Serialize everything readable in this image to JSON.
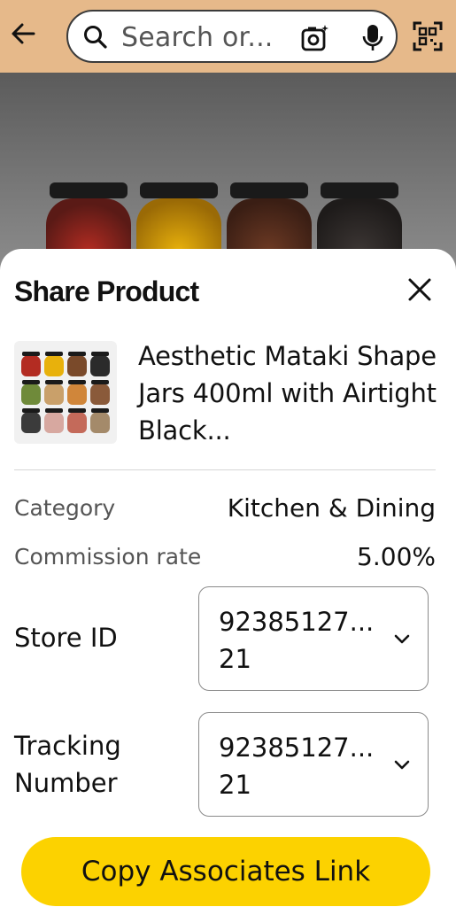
{
  "search": {
    "placeholder": "Search or..."
  },
  "icons": {
    "back": "arrow-left-icon",
    "search": "search-icon",
    "camera": "camera-icon",
    "mic": "microphone-icon",
    "qr": "qr-code-icon",
    "close": "close-icon",
    "chevron": "chevron-down-icon"
  },
  "colors": {
    "topbar": "#e6b98a",
    "button": "#fcd200"
  },
  "sheet": {
    "title": "Share Product",
    "product_title": "Aesthetic Mataki Shape Jars 400ml with Airtight Black...",
    "category_label": "Category",
    "category_value": "Kitchen & Dining",
    "commission_label": "Commission rate",
    "commission_value": "5.00%",
    "store_id_label": "Store ID",
    "store_id_value": "92385127...\n21",
    "tracking_label": "Tracking\nNumber",
    "tracking_value": "92385127...\n21",
    "copy_button": "Copy Associates Link"
  }
}
